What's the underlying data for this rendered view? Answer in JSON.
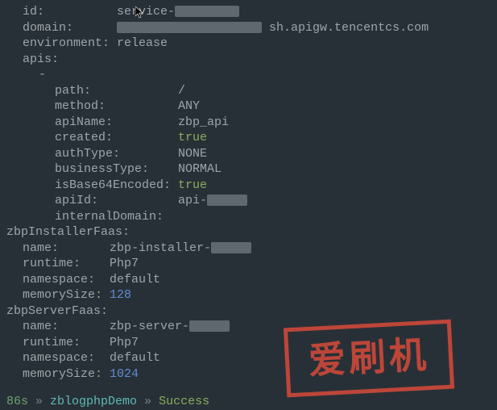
{
  "top": {
    "id_key": "id:",
    "id_val": "service-",
    "domain_key": "domain:",
    "domain_val_suffix": "sh.apigw.tencentcs.com",
    "env_key": "environment:",
    "env_val": "release",
    "apis_key": "apis:",
    "dash": "-"
  },
  "api": {
    "path_key": "path:",
    "path_val": "/",
    "method_key": "method:",
    "method_val": "ANY",
    "apiName_key": "apiName:",
    "apiName_val": "zbp_api",
    "created_key": "created:",
    "created_val": "true",
    "authType_key": "authType:",
    "authType_val": "NONE",
    "businessType_key": "businessType:",
    "businessType_val": "NORMAL",
    "isBase64_key": "isBase64Encoded:",
    "isBase64_val": "true",
    "apiId_key": "apiId:",
    "apiId_val": "api-",
    "internalDomain_key": "internalDomain:"
  },
  "installer": {
    "section": "zbpInstallerFaas:",
    "name_key": "name:",
    "name_val": "zbp-installer-",
    "runtime_key": "runtime:",
    "runtime_val": "Php7",
    "namespace_key": "namespace:",
    "namespace_val": "default",
    "memorySize_key": "memorySize:",
    "memorySize_val": "128"
  },
  "server": {
    "section": "zbpServerFaas:",
    "name_key": "name:",
    "name_val": "zbp-server-",
    "runtime_key": "runtime:",
    "runtime_val": "Php7",
    "namespace_key": "namespace:",
    "namespace_val": "default",
    "memorySize_key": "memorySize:",
    "memorySize_val": "1024"
  },
  "prompt": {
    "time": "86s",
    "sep": " » ",
    "proj": "zblogphpDemo",
    "status": "Success"
  },
  "watermark": "爱刷机"
}
